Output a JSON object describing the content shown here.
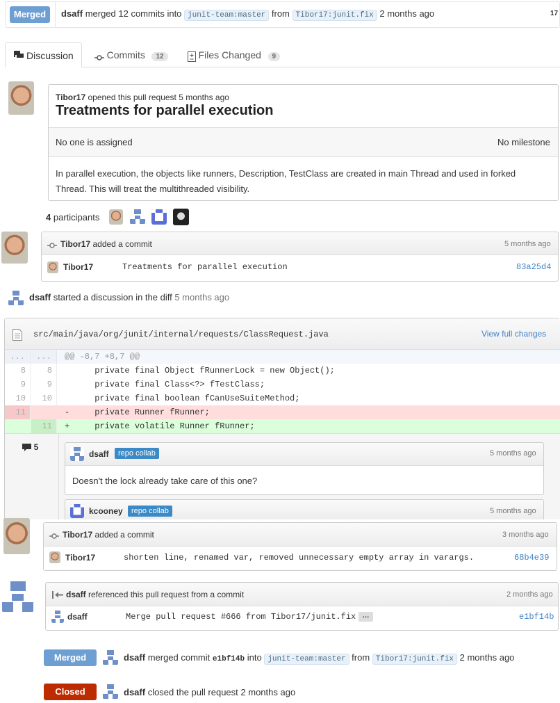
{
  "header": {
    "status": "Merged",
    "user": "dsaff",
    "action_text": "merged 12 commits into",
    "base_branch": "junit-team:master",
    "from_text": "from",
    "head_branch": "Tibor17:junit.fix",
    "time": "2 months ago",
    "cut_off": "17"
  },
  "tabs": [
    {
      "label": "Discussion",
      "count": ""
    },
    {
      "label": "Commits",
      "count": "12"
    },
    {
      "label": "Files Changed",
      "count": "9"
    }
  ],
  "pr": {
    "author": "Tibor17",
    "opened_text": "opened this pull request 5 months ago",
    "title": "Treatments for parallel execution",
    "assignee": "No one is assigned",
    "milestone": "No milestone",
    "description": "In parallel execution, the objects like runners, Description, TestClass are created in main Thread and used in forked Thread. This will treat the multithreaded visibility."
  },
  "participants": {
    "count": "4",
    "label": "participants"
  },
  "commit1": {
    "user": "Tibor17",
    "action": "added a commit",
    "time": "5 months ago",
    "author": "Tibor17",
    "message": "Treatments for parallel execution",
    "sha": "83a25d4"
  },
  "discussion": {
    "user": "dsaff",
    "action": "started a discussion in the diff",
    "time": "5 months ago",
    "file": "src/main/java/org/junit/internal/requests/ClassRequest.java",
    "view_full": "View full changes",
    "hunk_left": "...",
    "hunk_right": "...",
    "hunk": "@@ -8,7 +8,7 @@",
    "lines": [
      {
        "old": "8",
        "new": "8",
        "code": "      private final Object fRunnerLock = new Object();",
        "type": "ctx"
      },
      {
        "old": "9",
        "new": "9",
        "code": "      private final Class<?> fTestClass;",
        "type": "ctx"
      },
      {
        "old": "10",
        "new": "10",
        "code": "      private final boolean fCanUseSuiteMethod;",
        "type": "ctx"
      },
      {
        "old": "11",
        "new": "",
        "code": "-     private Runner fRunner;",
        "type": "del"
      },
      {
        "old": "",
        "new": "11",
        "code": "+     private volatile Runner fRunner;",
        "type": "add"
      }
    ],
    "comment_count": "5",
    "comments": [
      {
        "user": "dsaff",
        "tag": "repo collab",
        "time": "5 months ago",
        "body": "Doesn't the lock already take care of this one?"
      },
      {
        "user": "kcooney",
        "tag": "repo collab",
        "time": "5 months ago",
        "body": ""
      }
    ]
  },
  "commit2": {
    "user": "Tibor17",
    "action": "added a commit",
    "time": "3 months ago",
    "author": "Tibor17",
    "message": "shorten line, renamed var, removed unnecessary empty array in varargs.",
    "sha": "68b4e39"
  },
  "reference": {
    "user": "dsaff",
    "action": "referenced this pull request from a commit",
    "time": "2 months ago",
    "author": "dsaff",
    "message": "Merge pull request #666 from Tibor17/junit.fix",
    "ellipsis": "…",
    "sha": "e1bf14b"
  },
  "merged_event": {
    "status": "Merged",
    "user": "dsaff",
    "text1": "merged commit",
    "sha": "e1bf14b",
    "text2": "into",
    "base": "junit-team:master",
    "text3": "from",
    "head": "Tibor17:junit.fix",
    "time": "2 months ago"
  },
  "closed_event": {
    "status": "Closed",
    "user": "dsaff",
    "text": "closed the pull request",
    "time": "2 months ago"
  },
  "colors": {
    "merged": "#6e9fd2",
    "closed": "#bd2c00",
    "link": "#4183c4",
    "add_bg": "#dbffdb",
    "del_bg": "#ffdddd"
  }
}
